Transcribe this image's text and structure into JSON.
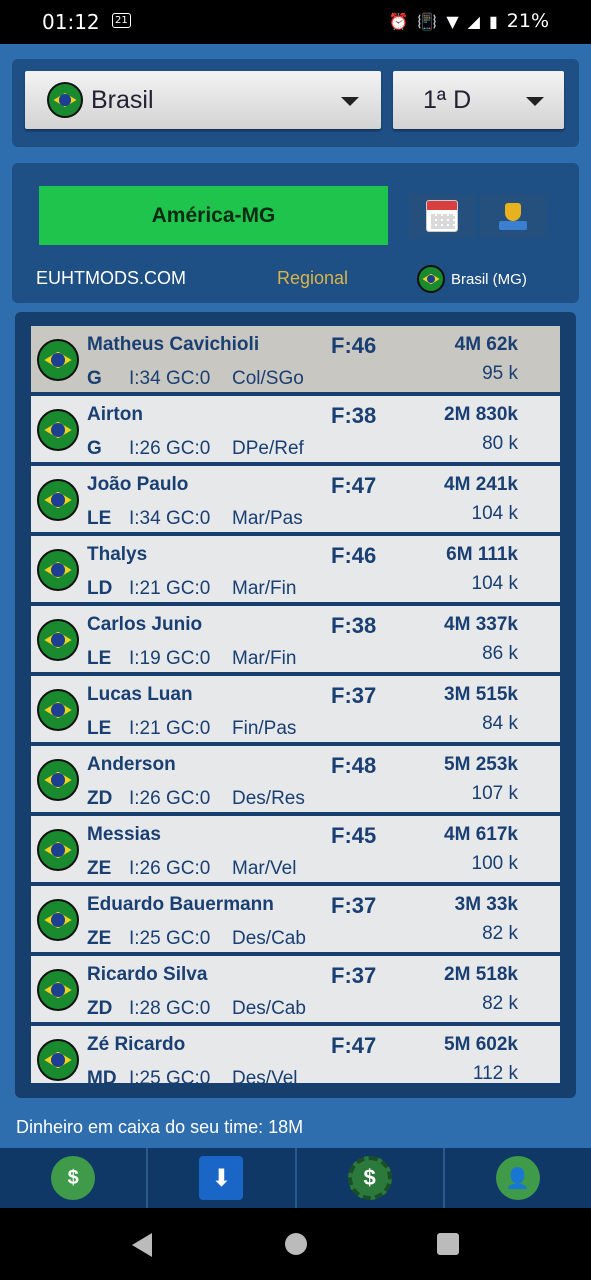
{
  "status_bar": {
    "time": "01:12",
    "badge": "21",
    "battery": "21%"
  },
  "selectors": {
    "country": "Brasil",
    "division": "1ª D"
  },
  "team": {
    "name": "América-MG",
    "site": "EUHTMODS.COM",
    "type": "Regional",
    "location": "Brasil (MG)"
  },
  "players": [
    {
      "name": "Matheus Cavichioli",
      "f": "F:46",
      "value": "4M 62k",
      "pos": "G",
      "stats": "I:34 GC:0",
      "role": "Col/SGo",
      "salary": "95 k"
    },
    {
      "name": "Airton",
      "f": "F:38",
      "value": "2M 830k",
      "pos": "G",
      "stats": "I:26 GC:0",
      "role": "DPe/Ref",
      "salary": "80 k"
    },
    {
      "name": "João Paulo",
      "f": "F:47",
      "value": "4M 241k",
      "pos": "LE",
      "stats": "I:34 GC:0",
      "role": "Mar/Pas",
      "salary": "104 k"
    },
    {
      "name": "Thalys",
      "f": "F:46",
      "value": "6M 111k",
      "pos": "LD",
      "stats": "I:21 GC:0",
      "role": "Mar/Fin",
      "salary": "104 k"
    },
    {
      "name": "Carlos Junio",
      "f": "F:38",
      "value": "4M 337k",
      "pos": "LE",
      "stats": "I:19 GC:0",
      "role": "Mar/Fin",
      "salary": "86 k"
    },
    {
      "name": "Lucas Luan",
      "f": "F:37",
      "value": "3M 515k",
      "pos": "LE",
      "stats": "I:21 GC:0",
      "role": "Fin/Pas",
      "salary": "84 k"
    },
    {
      "name": "Anderson",
      "f": "F:48",
      "value": "5M 253k",
      "pos": "ZD",
      "stats": "I:26 GC:0",
      "role": "Des/Res",
      "salary": "107 k"
    },
    {
      "name": "Messias",
      "f": "F:45",
      "value": "4M 617k",
      "pos": "ZE",
      "stats": "I:26 GC:0",
      "role": "Mar/Vel",
      "salary": "100 k"
    },
    {
      "name": "Eduardo Bauermann",
      "f": "F:37",
      "value": "3M 33k",
      "pos": "ZE",
      "stats": "I:25 GC:0",
      "role": "Des/Cab",
      "salary": "82 k"
    },
    {
      "name": "Ricardo Silva",
      "f": "F:37",
      "value": "2M 518k",
      "pos": "ZD",
      "stats": "I:28 GC:0",
      "role": "Des/Cab",
      "salary": "82 k"
    },
    {
      "name": "Zé Ricardo",
      "f": "F:47",
      "value": "5M 602k",
      "pos": "MD",
      "stats": "I:25 GC:0",
      "role": "Des/Vel",
      "salary": "112 k"
    }
  ],
  "footer": {
    "cash": "Dinheiro em caixa do seu time: 18M"
  },
  "tabs": [
    "money-bag-icon",
    "transfer-clock-icon",
    "coin-gear-icon",
    "manager-icon"
  ]
}
